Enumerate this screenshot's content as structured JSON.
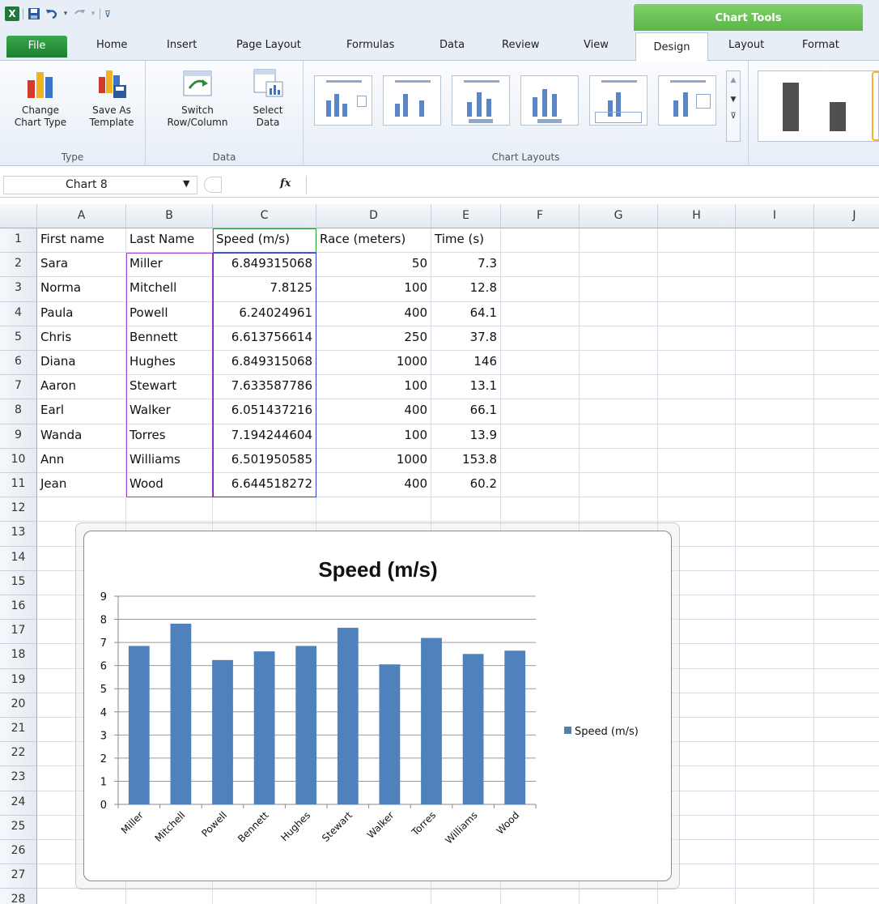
{
  "qat": {
    "logo": "X",
    "save_icon": "save-icon",
    "undo_icon": "undo-icon",
    "redo_icon": "redo-icon"
  },
  "context_tab": {
    "title": "Chart Tools"
  },
  "tabs": [
    {
      "label": "File"
    },
    {
      "label": "Home"
    },
    {
      "label": "Insert"
    },
    {
      "label": "Page Layout"
    },
    {
      "label": "Formulas"
    },
    {
      "label": "Data"
    },
    {
      "label": "Review"
    },
    {
      "label": "View"
    },
    {
      "label": "Design"
    },
    {
      "label": "Layout"
    },
    {
      "label": "Format"
    }
  ],
  "ribbon": {
    "type_group": {
      "label": "Type",
      "change_line1": "Change",
      "change_line2": "Chart Type",
      "save_line1": "Save As",
      "save_line2": "Template"
    },
    "data_group": {
      "label": "Data",
      "switch_line1": "Switch",
      "switch_line2": "Row/Column",
      "select_line1": "Select",
      "select_line2": "Data"
    },
    "layouts_group": {
      "label": "Chart Layouts"
    }
  },
  "formula_bar": {
    "name_box": "Chart 8",
    "fx": "fx",
    "value": ""
  },
  "columns": [
    "A",
    "B",
    "C",
    "D",
    "E",
    "F",
    "G",
    "H",
    "I",
    "J"
  ],
  "rows": [
    "1",
    "2",
    "3",
    "4",
    "5",
    "6",
    "7",
    "8",
    "9",
    "10",
    "11",
    "12",
    "13",
    "14",
    "15",
    "16",
    "17",
    "18",
    "19",
    "20",
    "21",
    "22",
    "23",
    "24",
    "25",
    "26",
    "27",
    "28"
  ],
  "table": {
    "headers": [
      "First name",
      "Last Name",
      "Speed (m/s)",
      "Race (meters)",
      "Time (s)"
    ],
    "rows": [
      [
        "Sara",
        "Miller",
        "6.849315068",
        "50",
        "7.3"
      ],
      [
        "Norma",
        "Mitchell",
        "7.8125",
        "100",
        "12.8"
      ],
      [
        "Paula",
        "Powell",
        "6.24024961",
        "400",
        "64.1"
      ],
      [
        "Chris",
        "Bennett",
        "6.613756614",
        "250",
        "37.8"
      ],
      [
        "Diana",
        "Hughes",
        "6.849315068",
        "1000",
        "146"
      ],
      [
        "Aaron",
        "Stewart",
        "7.633587786",
        "100",
        "13.1"
      ],
      [
        "Earl",
        "Walker",
        "6.051437216",
        "400",
        "66.1"
      ],
      [
        "Wanda",
        "Torres",
        "7.194244604",
        "100",
        "13.9"
      ],
      [
        "Ann",
        "Williams",
        "6.501950585",
        "1000",
        "153.8"
      ],
      [
        "Jean",
        "Wood",
        "6.644518272",
        "400",
        "60.2"
      ]
    ]
  },
  "colors": {
    "bar": "#4f81bd",
    "file_tab": "#2a8f3e",
    "chart_tools": "#6cc257"
  },
  "chart_data": {
    "type": "bar",
    "title": "Speed (m/s)",
    "categories": [
      "Miller",
      "Mitchell",
      "Powell",
      "Bennett",
      "Hughes",
      "Stewart",
      "Walker",
      "Torres",
      "Williams",
      "Wood"
    ],
    "series": [
      {
        "name": "Speed (m/s)",
        "values": [
          6.849315068,
          7.8125,
          6.24024961,
          6.613756614,
          6.849315068,
          7.633587786,
          6.051437216,
          7.194244604,
          6.501950585,
          6.644518272
        ]
      }
    ],
    "ylim": [
      0,
      9
    ],
    "yticks": [
      "0",
      "1",
      "2",
      "3",
      "4",
      "5",
      "6",
      "7",
      "8",
      "9"
    ],
    "grid": true,
    "legend": "right"
  }
}
